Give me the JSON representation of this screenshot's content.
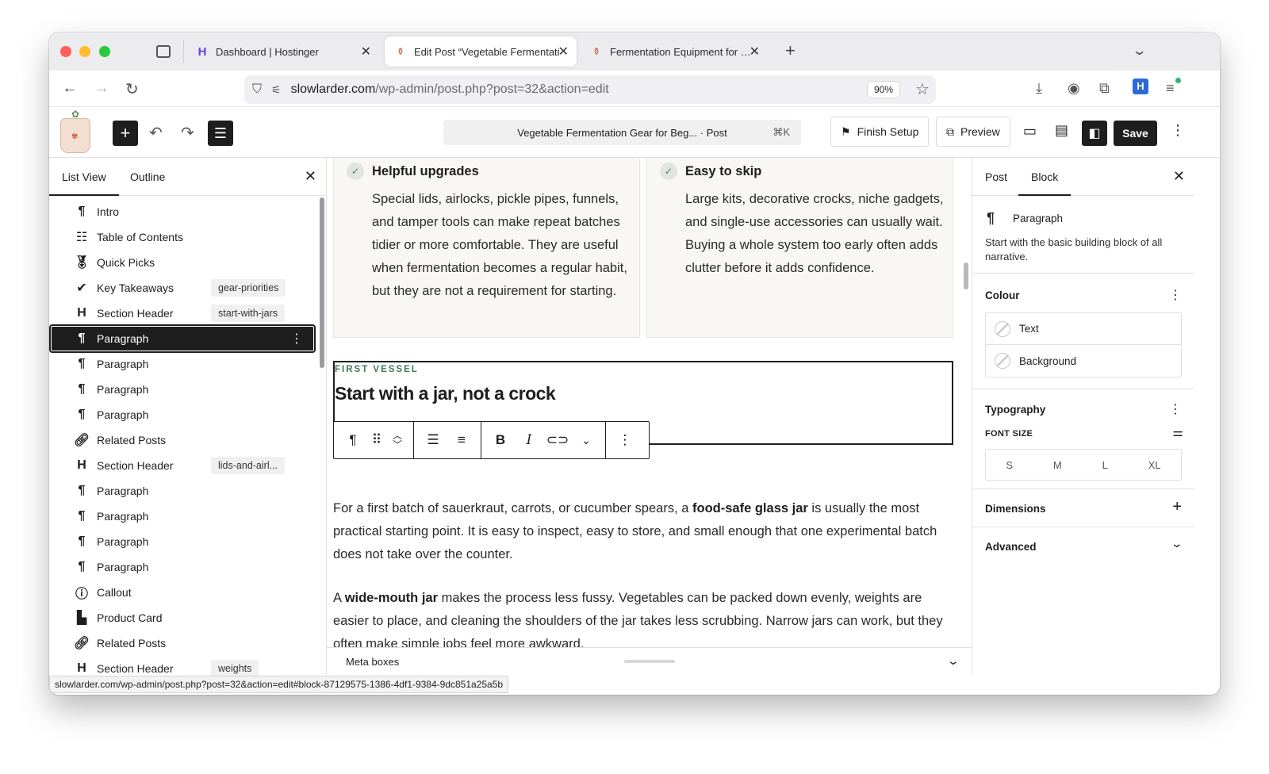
{
  "browser": {
    "tabs": [
      {
        "title": "Dashboard | Hostinger",
        "favicon": "hostinger-icon"
      },
      {
        "title": "Edit Post “Vegetable Fermentati",
        "favicon": "jar-icon"
      },
      {
        "title": "Fermentation Equipment for Beg",
        "favicon": "jar-icon"
      }
    ],
    "url_host": "slowlarder.com",
    "url_path": "/wp-admin/post.php?post=32&action=edit",
    "zoom": "90%",
    "status_url": "slowlarder.com/wp-admin/post.php?post=32&action=edit#block-87129575-1386-4df1-9384-9dc851a25a5b"
  },
  "editor": {
    "command_bar": "Vegetable Fermentation Gear for Beg... · Post",
    "command_shortcut": "⌘K",
    "finish_setup": "Finish Setup",
    "preview": "Preview",
    "save": "Save"
  },
  "list_view": {
    "tabs": [
      "List View",
      "Outline"
    ],
    "items": [
      {
        "icon": "paragraph-icon",
        "label": "Intro",
        "anchor": ""
      },
      {
        "icon": "table-of-contents-icon",
        "label": "Table of Contents",
        "anchor": ""
      },
      {
        "icon": "award-icon",
        "label": "Quick Picks",
        "anchor": ""
      },
      {
        "icon": "check-circle-icon",
        "label": "Key Takeaways",
        "anchor": "gear-priorities"
      },
      {
        "icon": "heading-icon",
        "label": "Section Header",
        "anchor": "start-with-jars"
      },
      {
        "icon": "paragraph-icon",
        "label": "Paragraph",
        "anchor": "",
        "selected": true
      },
      {
        "icon": "paragraph-icon",
        "label": "Paragraph",
        "anchor": ""
      },
      {
        "icon": "paragraph-icon",
        "label": "Paragraph",
        "anchor": ""
      },
      {
        "icon": "paragraph-icon",
        "label": "Paragraph",
        "anchor": ""
      },
      {
        "icon": "link-icon",
        "label": "Related Posts",
        "anchor": ""
      },
      {
        "icon": "heading-icon",
        "label": "Section Header",
        "anchor": "lids-and-airl..."
      },
      {
        "icon": "paragraph-icon",
        "label": "Paragraph",
        "anchor": ""
      },
      {
        "icon": "paragraph-icon",
        "label": "Paragraph",
        "anchor": ""
      },
      {
        "icon": "paragraph-icon",
        "label": "Paragraph",
        "anchor": ""
      },
      {
        "icon": "paragraph-icon",
        "label": "Paragraph",
        "anchor": ""
      },
      {
        "icon": "info-icon",
        "label": "Callout",
        "anchor": ""
      },
      {
        "icon": "shopping-bag-icon",
        "label": "Product Card",
        "anchor": ""
      },
      {
        "icon": "link-icon",
        "label": "Related Posts",
        "anchor": ""
      },
      {
        "icon": "heading-icon",
        "label": "Section Header",
        "anchor": "weights"
      }
    ]
  },
  "content": {
    "cards": [
      {
        "title": "Helpful upgrades",
        "body": "Special lids, airlocks, pickle pipes, funnels, and tamper tools can make repeat batches tidier or more comfortable. They are useful when fermentation becomes a regular habit, but they are not a requirement for starting."
      },
      {
        "title": "Easy to skip",
        "body": "Large kits, decorative crocks, niche gadgets, and single-use accessories can usually wait. Buying a whole system too early often adds clutter before it adds confidence."
      }
    ],
    "eyebrow": "FIRST VESSEL",
    "heading": "Start with a jar, not a crock",
    "para1": {
      "a": "For a first batch of sauerkraut, carrots, or cucumber spears, a ",
      "b": "food-safe glass jar",
      "c": " is usually the most practical starting point. It is easy to inspect, easy to store, and small enough that one experimental batch does not take over the counter."
    },
    "para2": {
      "a": "A ",
      "b": "wide-mouth jar",
      "c": " makes the process less fussy. Vegetables can be packed down evenly, weights are easier to place, and cleaning the shoulders of the jar takes less scrubbing. Narrow jars can work, but they often make simple jobs feel more awkward."
    },
    "meta_boxes": "Meta boxes"
  },
  "settings": {
    "tabs": [
      "Post",
      "Block"
    ],
    "block_name": "Paragraph",
    "block_desc": "Start with the basic building block of all narrative.",
    "colour_label": "Colour",
    "colour_text": "Text",
    "colour_background": "Background",
    "typography_label": "Typography",
    "font_size_label": "FONT SIZE",
    "font_sizes": [
      "S",
      "M",
      "L",
      "XL"
    ],
    "dimensions_label": "Dimensions",
    "advanced_label": "Advanced"
  }
}
